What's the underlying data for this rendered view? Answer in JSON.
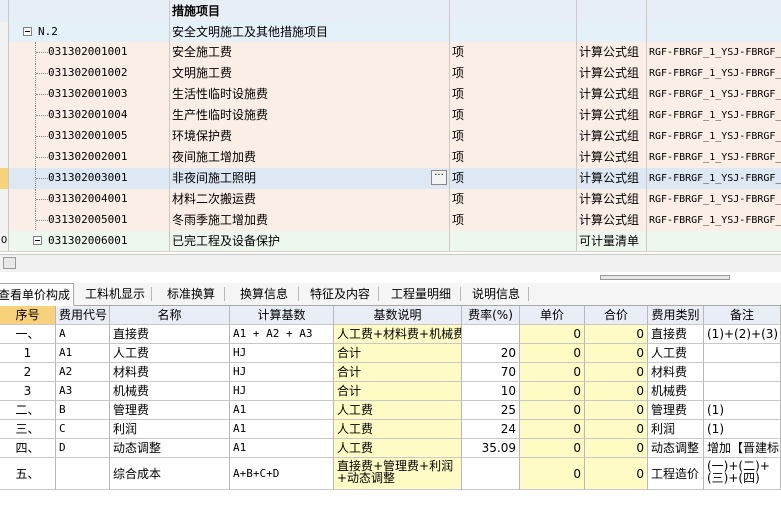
{
  "top_grid": {
    "header_title": "措施项目",
    "group_row": {
      "code": "N.2",
      "name": "安全文明施工及其他措施项目"
    },
    "rows": [
      {
        "code": "031302001001",
        "name": "安全施工费",
        "unit": "项",
        "calc": "计算公式组",
        "group": "RGF-FBRGF_1_YSJ-FBRGF_"
      },
      {
        "code": "031302001002",
        "name": "文明施工费",
        "unit": "项",
        "calc": "计算公式组",
        "group": "RGF-FBRGF_1_YSJ-FBRGF_"
      },
      {
        "code": "031302001003",
        "name": "生活性临时设施费",
        "unit": "项",
        "calc": "计算公式组",
        "group": "RGF-FBRGF_1_YSJ-FBRGF_"
      },
      {
        "code": "031302001004",
        "name": "生产性临时设施费",
        "unit": "项",
        "calc": "计算公式组",
        "group": "RGF-FBRGF_1_YSJ-FBRGF_"
      },
      {
        "code": "031302001005",
        "name": "环境保护费",
        "unit": "项",
        "calc": "计算公式组",
        "group": "RGF-FBRGF_1_YSJ-FBRGF_"
      },
      {
        "code": "031302002001",
        "name": "夜间施工增加费",
        "unit": "项",
        "calc": "计算公式组",
        "group": "RGF-FBRGF_1_YSJ-FBRGF_"
      },
      {
        "code": "031302003001",
        "name": "非夜间施工照明",
        "unit": "项",
        "calc": "计算公式组",
        "group": "RGF-FBRGF_1_YSJ-FBRGF_",
        "selected": true
      },
      {
        "code": "031302004001",
        "name": "材料二次搬运费",
        "unit": "项",
        "calc": "计算公式组",
        "group": "RGF-FBRGF_1_YSJ-FBRGF_"
      },
      {
        "code": "031302005001",
        "name": "冬雨季施工增加费",
        "unit": "项",
        "calc": "计算公式组",
        "group": "RGF-FBRGF_1_YSJ-FBRGF_"
      }
    ],
    "last_row": {
      "gutter": "0",
      "code": "031302006001",
      "name": "已完工程及设备保护",
      "calc": "可计量清单"
    },
    "ellipsis_label": "···"
  },
  "tabs": [
    "查看单价构成",
    "工料机显示",
    "标准换算",
    "换算信息",
    "特征及内容",
    "工程量明细",
    "说明信息"
  ],
  "bottom_grid": {
    "headers": [
      "序号",
      "费用代号",
      "名称",
      "计算基数",
      "基数说明",
      "费率(%)",
      "单价",
      "合价",
      "费用类别",
      "备注"
    ],
    "rows": [
      {
        "seq": "一、",
        "code": "A",
        "name": "直接费",
        "base": "A1 + A2 + A3",
        "desc": "人工费+材料费+机械费",
        "rate": "",
        "price": "0",
        "total": "0",
        "cat": "直接费",
        "note": "(1)+(2)+(3)"
      },
      {
        "seq": "1",
        "code": "A1",
        "name": "人工费",
        "base": "HJ",
        "desc": "合计",
        "rate": "20",
        "price": "0",
        "total": "0",
        "cat": "人工费",
        "note": ""
      },
      {
        "seq": "2",
        "code": "A2",
        "name": "材料费",
        "base": "HJ",
        "desc": "合计",
        "rate": "70",
        "price": "0",
        "total": "0",
        "cat": "材料费",
        "note": ""
      },
      {
        "seq": "3",
        "code": "A3",
        "name": "机械费",
        "base": "HJ",
        "desc": "合计",
        "rate": "10",
        "price": "0",
        "total": "0",
        "cat": "机械费",
        "note": ""
      },
      {
        "seq": "二、",
        "code": "B",
        "name": "管理费",
        "base": "A1",
        "desc": "人工费",
        "rate": "25",
        "price": "0",
        "total": "0",
        "cat": "管理费",
        "note": "(1)"
      },
      {
        "seq": "三、",
        "code": "C",
        "name": "利润",
        "base": "A1",
        "desc": "人工费",
        "rate": "24",
        "price": "0",
        "total": "0",
        "cat": "利润",
        "note": "(1)"
      },
      {
        "seq": "四、",
        "code": "D",
        "name": "动态调整",
        "base": "A1",
        "desc": "人工费",
        "rate": "35.09",
        "price": "0",
        "total": "0",
        "cat": "动态调整",
        "note": "增加【晋建标字"
      },
      {
        "seq": "五、",
        "code": "",
        "name": "综合成本",
        "base": "A+B+C+D",
        "desc": "直接费+管理费+利润+动态调整",
        "rate": "",
        "price": "0",
        "total": "0",
        "cat": "工程造价",
        "note": "(一)+(二)+(三)+(四)"
      }
    ]
  },
  "colors": {
    "row_bg": "#fbeee6",
    "selected_row_bg": "#dde8f4",
    "group_row_bg": "#e4f1f8",
    "last_row_bg": "#eef7ee",
    "header_bg": "#e8eef6",
    "selected_header_bg": "#f7d27a",
    "highlight_yellow": "#fffbc4"
  }
}
